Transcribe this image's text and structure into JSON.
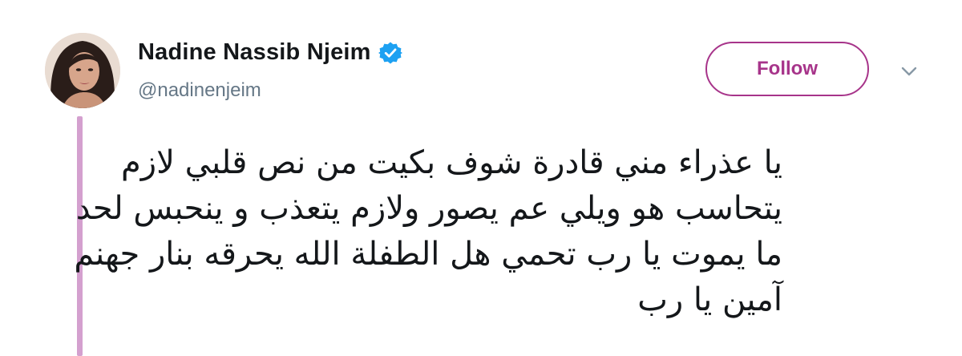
{
  "author": {
    "display_name": "Nadine Nassib Njeim",
    "handle": "@nadinenjeim",
    "verified_icon": "verified-badge-icon",
    "avatar_icon": "profile-photo-avatar"
  },
  "actions": {
    "follow_label": "Follow",
    "menu_icon": "chevron-down-icon"
  },
  "tweet": {
    "lines": [
      "يا عذراء مني قادرة شوف بكيت من نص قلبي لازم",
      "يتحاسب هو ويلي عم يصور ولازم يتعذب و ينحبس لحد",
      "ما يموت يا رب تحمي هل الطفلة الله يحرقه بنار جهنم",
      "آمين يا رب"
    ]
  },
  "colors": {
    "accent": "#a7348a",
    "thread_line": "#d4a0cf",
    "verified": "#1da1f2",
    "text": "#14171a",
    "secondary_text": "#657786"
  }
}
